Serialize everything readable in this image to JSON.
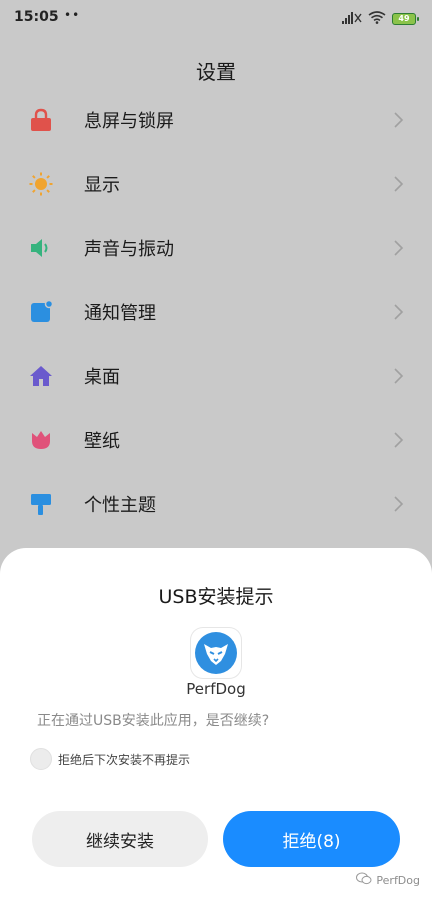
{
  "status_bar": {
    "time": "15:05",
    "dots": "••",
    "battery": "49"
  },
  "page": {
    "title": "设置"
  },
  "settings": [
    {
      "label": "息屏与锁屏",
      "icon": "lock-icon",
      "color": "#e0524b"
    },
    {
      "label": "显示",
      "icon": "sun-icon",
      "color": "#f0a430"
    },
    {
      "label": "声音与振动",
      "icon": "speaker-icon",
      "color": "#36b37e"
    },
    {
      "label": "通知管理",
      "icon": "notification-icon",
      "color": "#2b8fe0"
    },
    {
      "label": "桌面",
      "icon": "home-icon",
      "color": "#6a5acd"
    },
    {
      "label": "壁纸",
      "icon": "tulip-icon",
      "color": "#e0527a"
    },
    {
      "label": "个性主题",
      "icon": "brush-icon",
      "color": "#2b8fe0"
    }
  ],
  "dialog": {
    "title": "USB安装提示",
    "app_name": "PerfDog",
    "message": "正在通过USB安装此应用，是否继续?",
    "checkbox_label": "拒绝后下次安装不再提示",
    "continue_label": "继续安装",
    "reject_label": "拒绝(8)",
    "accent": "#1a8cff"
  },
  "watermark": {
    "text": "PerfDog"
  }
}
